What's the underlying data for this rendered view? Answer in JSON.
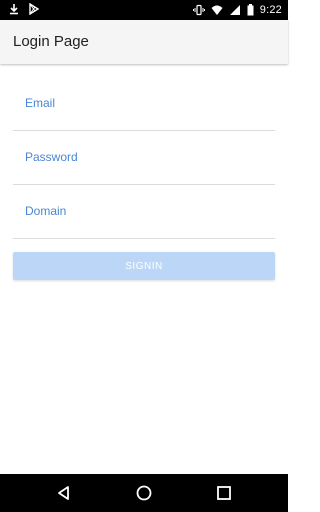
{
  "status_bar": {
    "time": "9:22",
    "icons": [
      "download-icon",
      "play-store-icon",
      "vibrate-icon",
      "wifi-icon",
      "signal-icon",
      "battery-icon"
    ]
  },
  "app_bar": {
    "title": "Login Page"
  },
  "form": {
    "email": {
      "label": "Email",
      "value": ""
    },
    "password": {
      "label": "Password",
      "value": ""
    },
    "domain": {
      "label": "Domain",
      "value": ""
    },
    "signin_label": "SIGNIN"
  },
  "colors": {
    "accent": "#4a86d4",
    "button_disabled": "#bcd6f8",
    "app_bar": "#f5f5f5"
  },
  "nav_bar": {
    "buttons": [
      "back-icon",
      "home-icon",
      "recents-icon"
    ]
  }
}
